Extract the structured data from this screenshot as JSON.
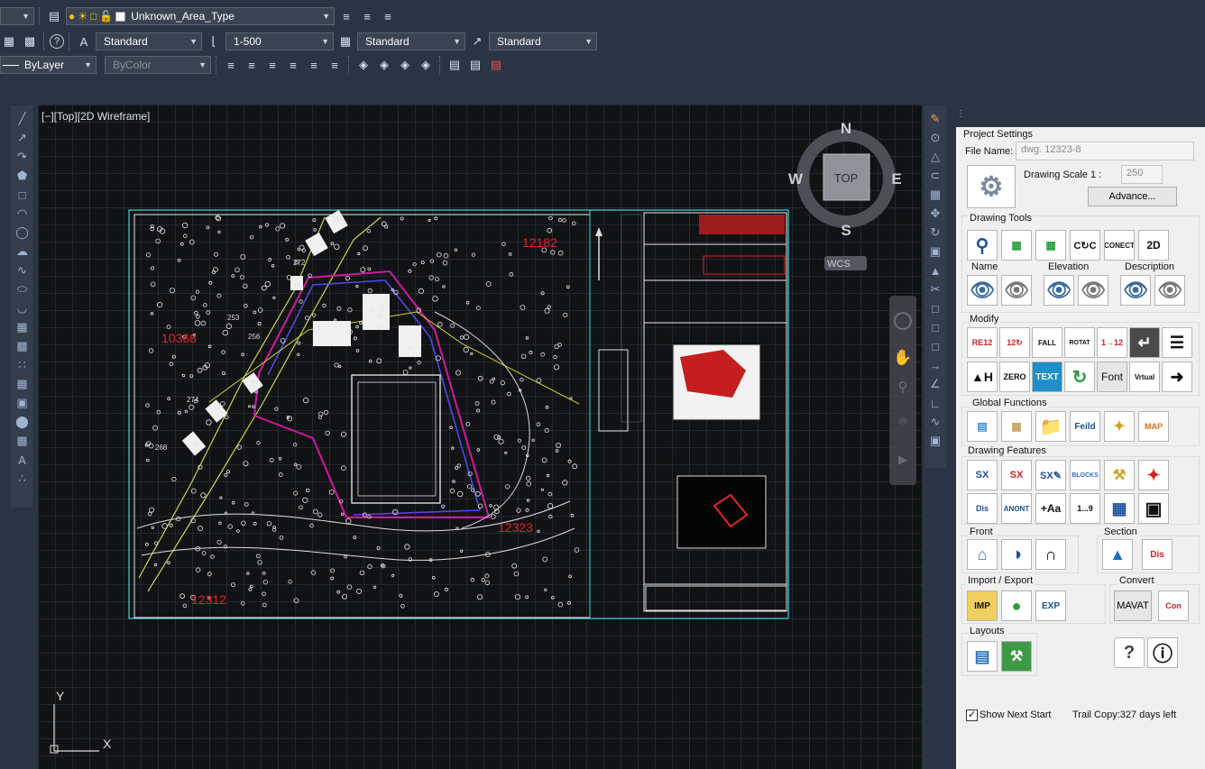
{
  "toolbar1": {
    "layer_name": "Unknown_Area_Type"
  },
  "toolbar2": {
    "text_style": "Standard",
    "dim_scale": "1-500",
    "table_style": "Standard",
    "mleader_style": "Standard"
  },
  "toolbar3": {
    "linetype": "ByLayer",
    "color": "ByColor"
  },
  "viewport": {
    "label": "[−][Top][2D Wireframe]"
  },
  "viewcube": {
    "north": "N",
    "south": "S",
    "east": "E",
    "west": "W",
    "top": "TOP",
    "wcs": "WCS"
  },
  "drawing": {
    "parcels": [
      "12182",
      "10368",
      "12323",
      "12312"
    ],
    "lots": [
      "256",
      "272",
      "253",
      "256",
      "274",
      "268"
    ]
  },
  "ucs": {
    "x": "X",
    "y": "Y"
  },
  "panel": {
    "project_settings": "Project Settings",
    "file_name_label": "File Name:",
    "file_name_value": "dwg. 12323-8",
    "drawing_scale_label": "Drawing Scale  1 :",
    "drawing_scale_value": "250",
    "advance_button": "Advance...",
    "drawing_tools": "Drawing Tools",
    "name_label": "Name",
    "elevation_label": "Elevation",
    "description_label": "Description",
    "modify": "Modify",
    "font_button": "Font",
    "global_functions": "Global Functions",
    "drawing_features": "Drawing Features",
    "front": "Front",
    "section": "Section",
    "import_export": "Import / Export",
    "convert": "Convert",
    "mavat_button": "MAVAT",
    "layouts": "Layouts",
    "show_next_start": "Show Next Start",
    "trial_copy": "Trail Copy:327 days left"
  },
  "colors": {
    "background": "#2b3444",
    "canvas": "#111214",
    "panel": "#f0f0f0",
    "cyan_frame": "#3ad7e0",
    "parcel_red": "#e3232a"
  }
}
